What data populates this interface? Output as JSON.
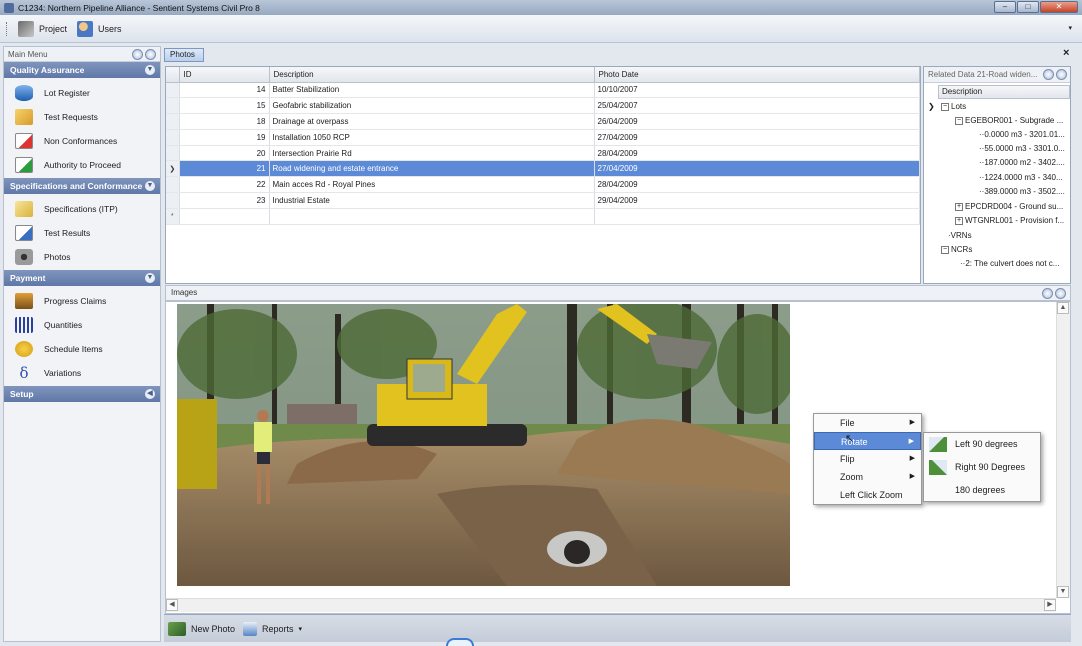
{
  "window": {
    "title": "C1234: Northern Pipeline Alliance - Sentient Systems Civil Pro 8"
  },
  "toolbar": {
    "project_label": "Project",
    "users_label": "Users"
  },
  "sidebar": {
    "header": "Main Menu",
    "sections": [
      {
        "title": "Quality Assurance",
        "items": [
          "Lot Register",
          "Test Requests",
          "Non Conformances",
          "Authority to Proceed"
        ]
      },
      {
        "title": "Specifications and Conformance",
        "items": [
          "Specifications (ITP)",
          "Test Results",
          "Photos"
        ]
      },
      {
        "title": "Payment",
        "items": [
          "Progress Claims",
          "Quantities",
          "Schedule Items",
          "Variations"
        ]
      },
      {
        "title": "Setup",
        "items": []
      }
    ]
  },
  "photos_tab": "Photos",
  "grid": {
    "columns": [
      "ID",
      "Description",
      "Photo Date"
    ],
    "rows": [
      {
        "id": "14",
        "description": "Batter Stabilization",
        "date": "10/10/2007"
      },
      {
        "id": "15",
        "description": "Geofabric stabilization",
        "date": "25/04/2007"
      },
      {
        "id": "18",
        "description": "Drainage at overpass",
        "date": "26/04/2009"
      },
      {
        "id": "19",
        "description": "Installation 1050 RCP",
        "date": "27/04/2009"
      },
      {
        "id": "20",
        "description": "Intersection Prairie Rd",
        "date": "28/04/2009"
      },
      {
        "id": "21",
        "description": "Road widening and estate entrance",
        "date": "27/04/2009"
      },
      {
        "id": "22",
        "description": "Main acces Rd - Royal Pines",
        "date": "28/04/2009"
      },
      {
        "id": "23",
        "description": "Industrial Estate",
        "date": "29/04/2009"
      }
    ],
    "selected_index": 5
  },
  "related": {
    "title": "Related Data 21-Road widen...",
    "column": "Description",
    "nodes": [
      "Lots",
      "EGEBOR001 - Subgrade ...",
      "0.0000 m3 - 3201.01...",
      "55.0000 m3 - 3301.0...",
      "187.0000 m2 - 3402....",
      "1224.0000 m3 - 340...",
      "389.0000 m3 - 3502....",
      "EPCDRD004 - Ground su...",
      "WTGNRL001 - Provision f...",
      "VRNs",
      "NCRs",
      "2: The culvert does not c..."
    ]
  },
  "images": {
    "label": "Images"
  },
  "context_menu": {
    "items": [
      "File",
      "Rotate",
      "Flip",
      "Zoom",
      "Left Click Zoom"
    ],
    "highlighted": "Rotate",
    "submenu": [
      "Left 90 degrees",
      "Right 90 Degrees",
      "180 degrees"
    ]
  },
  "bottom": {
    "new_photo": "New Photo",
    "reports": "Reports"
  },
  "colors": {
    "accent": "#5c8ad6",
    "section_header": "#6d84b2"
  }
}
